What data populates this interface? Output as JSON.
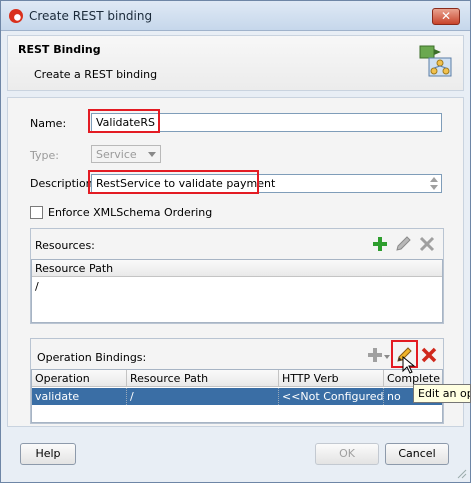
{
  "window": {
    "title": "Create REST binding"
  },
  "header": {
    "title": "REST Binding",
    "subtitle": "Create a REST binding"
  },
  "form": {
    "name_label": "Name:",
    "name_value": "ValidateRS",
    "type_label": "Type:",
    "type_value": "Service",
    "description_label": "Description:",
    "description_value": "RestService to validate payment",
    "enforce_label": "Enforce XMLSchema Ordering",
    "enforce_checked": false
  },
  "resources": {
    "title": "Resources:",
    "column": "Resource Path",
    "rows": [
      "/"
    ]
  },
  "operations": {
    "title": "Operation Bindings:",
    "columns": [
      "Operation",
      "Resource Path",
      "HTTP Verb",
      "Complete"
    ],
    "rows": [
      {
        "operation": "validate",
        "resource_path": "/",
        "http_verb": "<<Not Configured...",
        "complete": "no"
      }
    ]
  },
  "tooltip": "Edit an operation",
  "buttons": {
    "help": "Help",
    "ok": "OK",
    "cancel": "Cancel"
  },
  "colors": {
    "highlight": "#e31b23",
    "selection": "#3a6ea5",
    "add": "#2e9e2e",
    "delete": "#d0281c"
  },
  "icons": [
    "app-icon",
    "close-icon",
    "rest-binding-icon",
    "add-icon",
    "edit-icon",
    "delete-icon",
    "cursor-icon"
  ]
}
